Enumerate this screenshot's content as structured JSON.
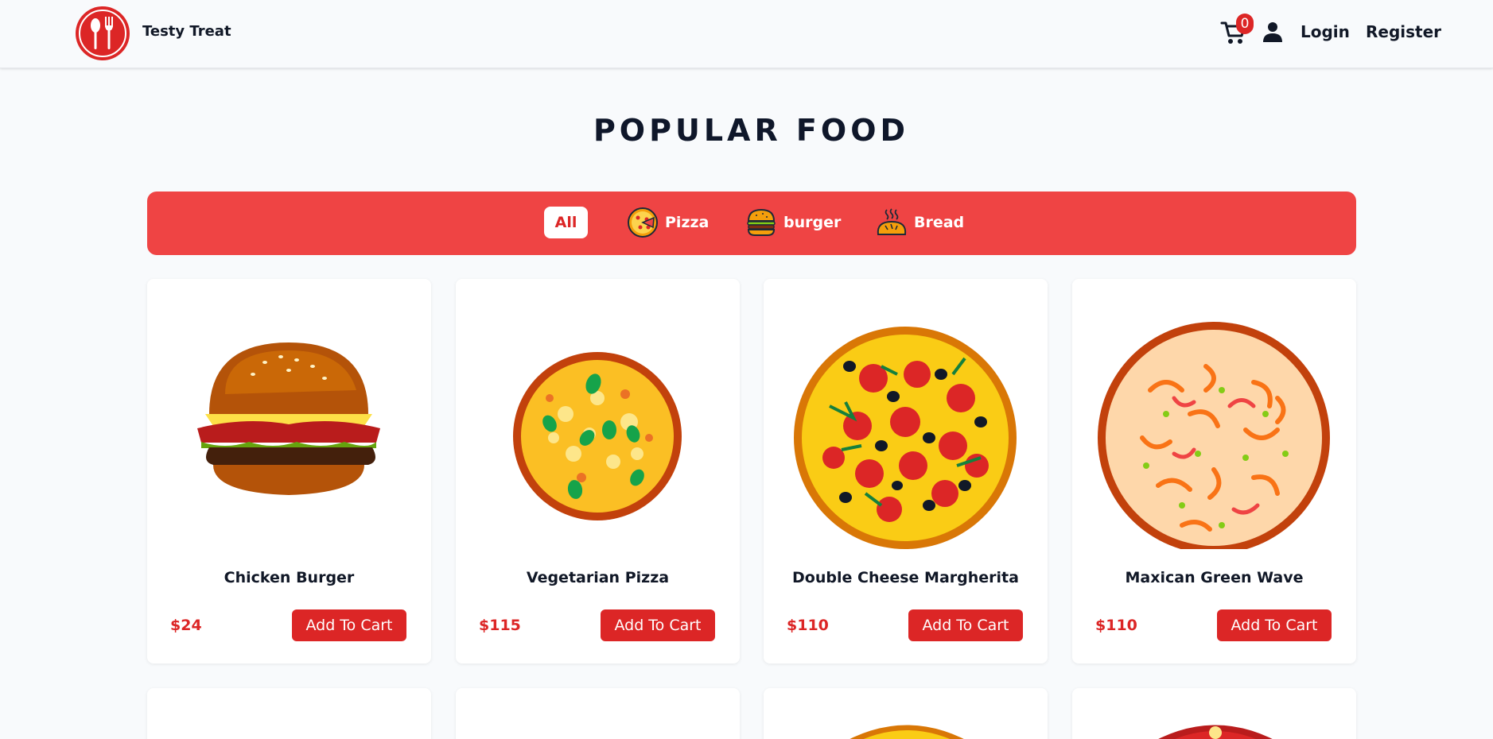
{
  "header": {
    "brand": "Testy Treat",
    "cart_count": "0",
    "login_label": "Login",
    "register_label": "Register"
  },
  "title": "POPULAR FOOD",
  "filters": {
    "all": "All",
    "pizza": "Pizza",
    "burger": "burger",
    "bread": "Bread"
  },
  "products": [
    {
      "name": "Chicken Burger",
      "price": "$24",
      "button": "Add To Cart",
      "image": "burger-image"
    },
    {
      "name": "Vegetarian Pizza",
      "price": "$115",
      "button": "Add To Cart",
      "image": "veg-pizza-image"
    },
    {
      "name": "Double Cheese Margherita",
      "price": "$110",
      "button": "Add To Cart",
      "image": "pepperoni-pizza-image"
    },
    {
      "name": "Maxican Green Wave",
      "price": "$110",
      "button": "Add To Cart",
      "image": "pepper-pizza-image"
    }
  ],
  "colors": {
    "accent": "#ef4444",
    "button": "#dc2626",
    "background": "#f8fafc"
  }
}
